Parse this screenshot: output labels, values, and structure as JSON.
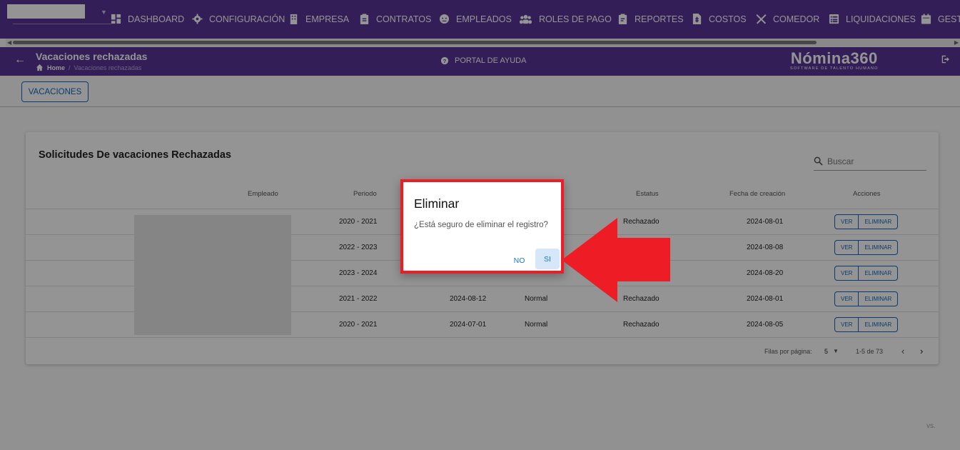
{
  "nav": {
    "items": [
      {
        "label": "DASHBOARD",
        "icon": "dashboard-icon"
      },
      {
        "label": "CONFIGURACIÓN",
        "icon": "gear-icon"
      },
      {
        "label": "EMPRESA",
        "icon": "building-icon"
      },
      {
        "label": "CONTRATOS",
        "icon": "clipboard-icon"
      },
      {
        "label": "EMPLEADOS",
        "icon": "face-icon"
      },
      {
        "label": "ROLES DE PAGO",
        "icon": "users-icon"
      },
      {
        "label": "REPORTES",
        "icon": "report-icon"
      },
      {
        "label": "COSTOS",
        "icon": "document-dollar-icon"
      },
      {
        "label": "COMEDOR",
        "icon": "utensils-icon"
      },
      {
        "label": "LIQUIDACIONES",
        "icon": "list-icon"
      },
      {
        "label": "GEST",
        "icon": "calendar-icon"
      }
    ]
  },
  "header": {
    "title": "Vacaciones rechazadas",
    "breadcrumb_home": "Home",
    "breadcrumb_sep": "/",
    "breadcrumb_current": "Vacaciones rechazadas",
    "help_label": "PORTAL DE AYUDA",
    "logo_main": "Nómina360",
    "logo_sub": "SOFTWARE DE TALENTO HUMANO"
  },
  "toolbar": {
    "vacaciones_label": "VACACIONES"
  },
  "card": {
    "title": "Solicitudes De vacaciones Rechazadas",
    "search_placeholder": "Buscar",
    "columns": {
      "empleado": "Empleado",
      "periodo": "Periodo",
      "estatus": "Estatus",
      "fecha_creacion": "Fecha de creación",
      "acciones": "Acciones"
    },
    "rows": [
      {
        "periodo": "2020 - 2021",
        "fecha": "",
        "tipo": "",
        "estatus": "Rechazado",
        "creacion": "2024-08-01"
      },
      {
        "periodo": "2022 - 2023",
        "fecha": "",
        "tipo": "",
        "estatus": "",
        "creacion": "2024-08-08"
      },
      {
        "periodo": "2023 - 2024",
        "fecha": "",
        "tipo": "",
        "estatus": "",
        "creacion": "2024-08-20"
      },
      {
        "periodo": "2021 - 2022",
        "fecha": "2024-08-12",
        "tipo": "Normal",
        "estatus": "Rechazado",
        "creacion": "2024-08-01"
      },
      {
        "periodo": "2020 - 2021",
        "fecha": "2024-07-01",
        "tipo": "Normal",
        "estatus": "Rechazado",
        "creacion": "2024-08-05"
      }
    ],
    "actions": {
      "ver": "VER",
      "eliminar": "ELIMINAR"
    },
    "pagination": {
      "rows_label": "Filas por página:",
      "rows_value": "5",
      "range": "1-5 de 73"
    }
  },
  "dialog": {
    "title": "Eliminar",
    "message": "¿Está seguro de eliminar el registro?",
    "no_label": "NO",
    "si_label": "SI"
  },
  "colors": {
    "nav": "#5b3598",
    "accent": "#1565c0",
    "highlight": "#ee1c25"
  }
}
